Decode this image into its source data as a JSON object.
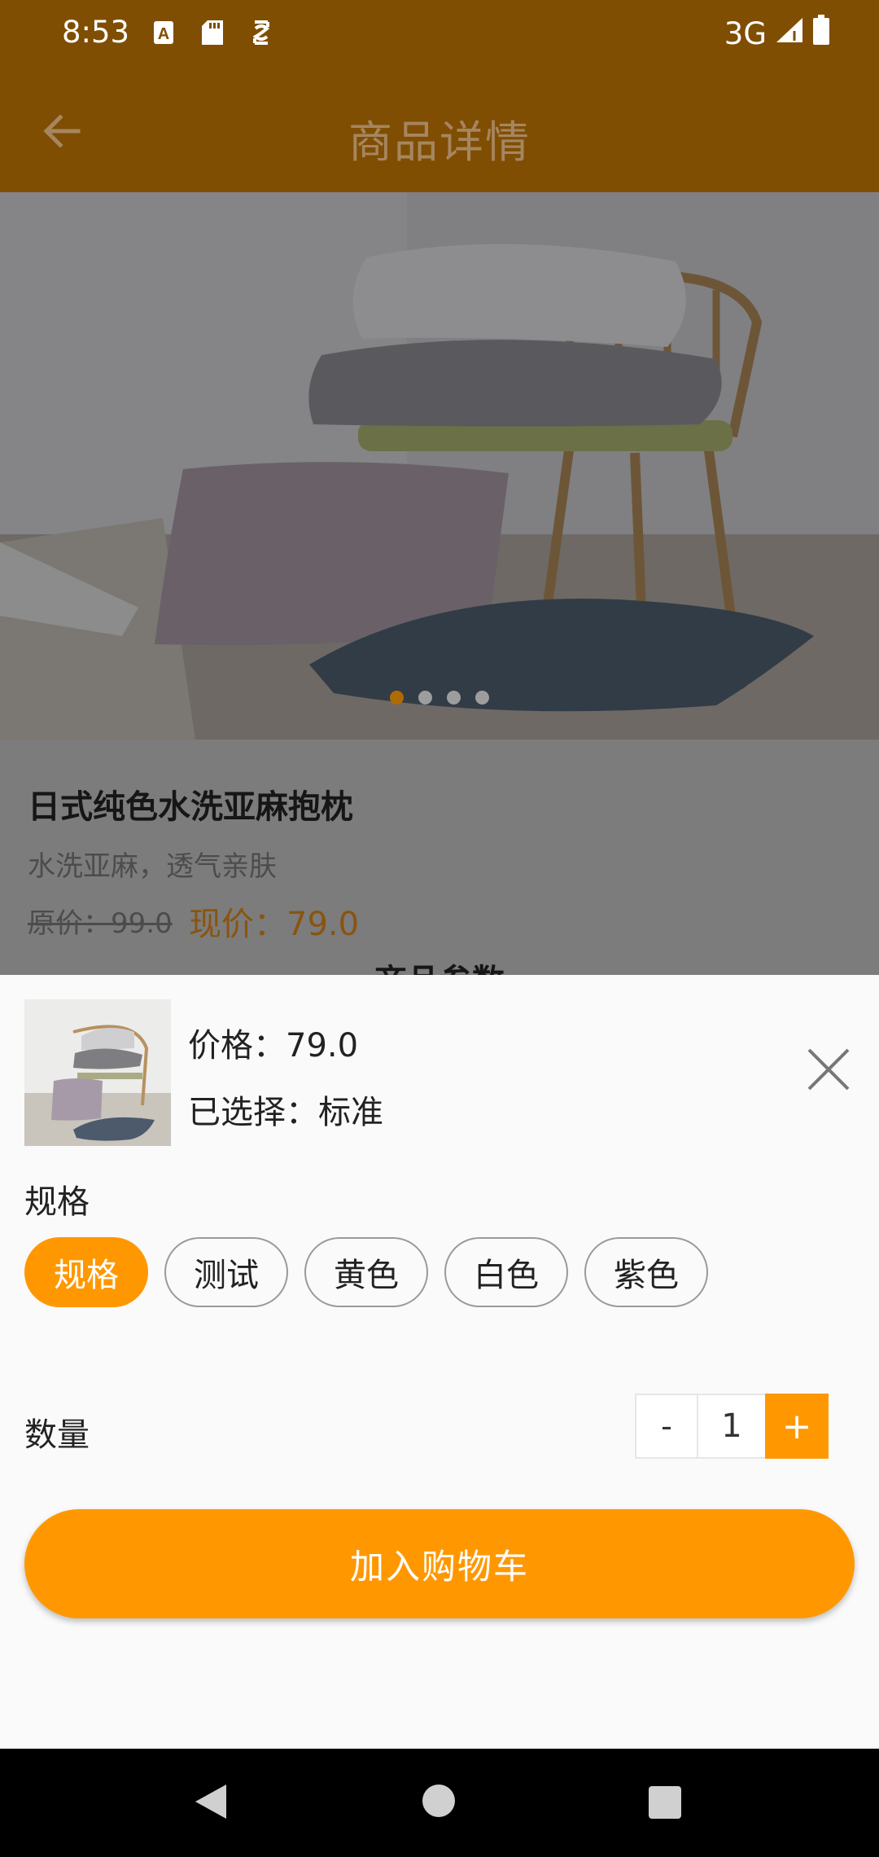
{
  "status_bar": {
    "time": "8:53",
    "network": "3G",
    "icons": [
      "a-notification-icon",
      "sd-card-icon",
      "sync-app-icon",
      "signal-icon",
      "battery-icon"
    ]
  },
  "toolbar": {
    "title": "商品详情",
    "back_icon": "arrow-left-icon"
  },
  "carousel": {
    "page_count": 4,
    "active_index": 0
  },
  "product": {
    "title": "日式纯色水洗亚麻抱枕",
    "subtitle": "水洗亚麻，透气亲肤",
    "original_price": "原价：99.0",
    "current_price": "现价：79.0",
    "params_heading": "商品参数"
  },
  "sheet": {
    "price_text": "价格：79.0",
    "selected_text": "已选择：标准",
    "spec_label": "规格",
    "spec_options": [
      "规格",
      "测试",
      "黄色",
      "白色",
      "紫色"
    ],
    "active_spec_index": 0,
    "quantity_label": "数量",
    "minus_label": "-",
    "quantity_value": "1",
    "plus_label": "+",
    "add_to_cart_label": "加入购物车"
  },
  "colors": {
    "accent": "#ff9800",
    "toolbar_dimmed": "#7f4e02"
  }
}
